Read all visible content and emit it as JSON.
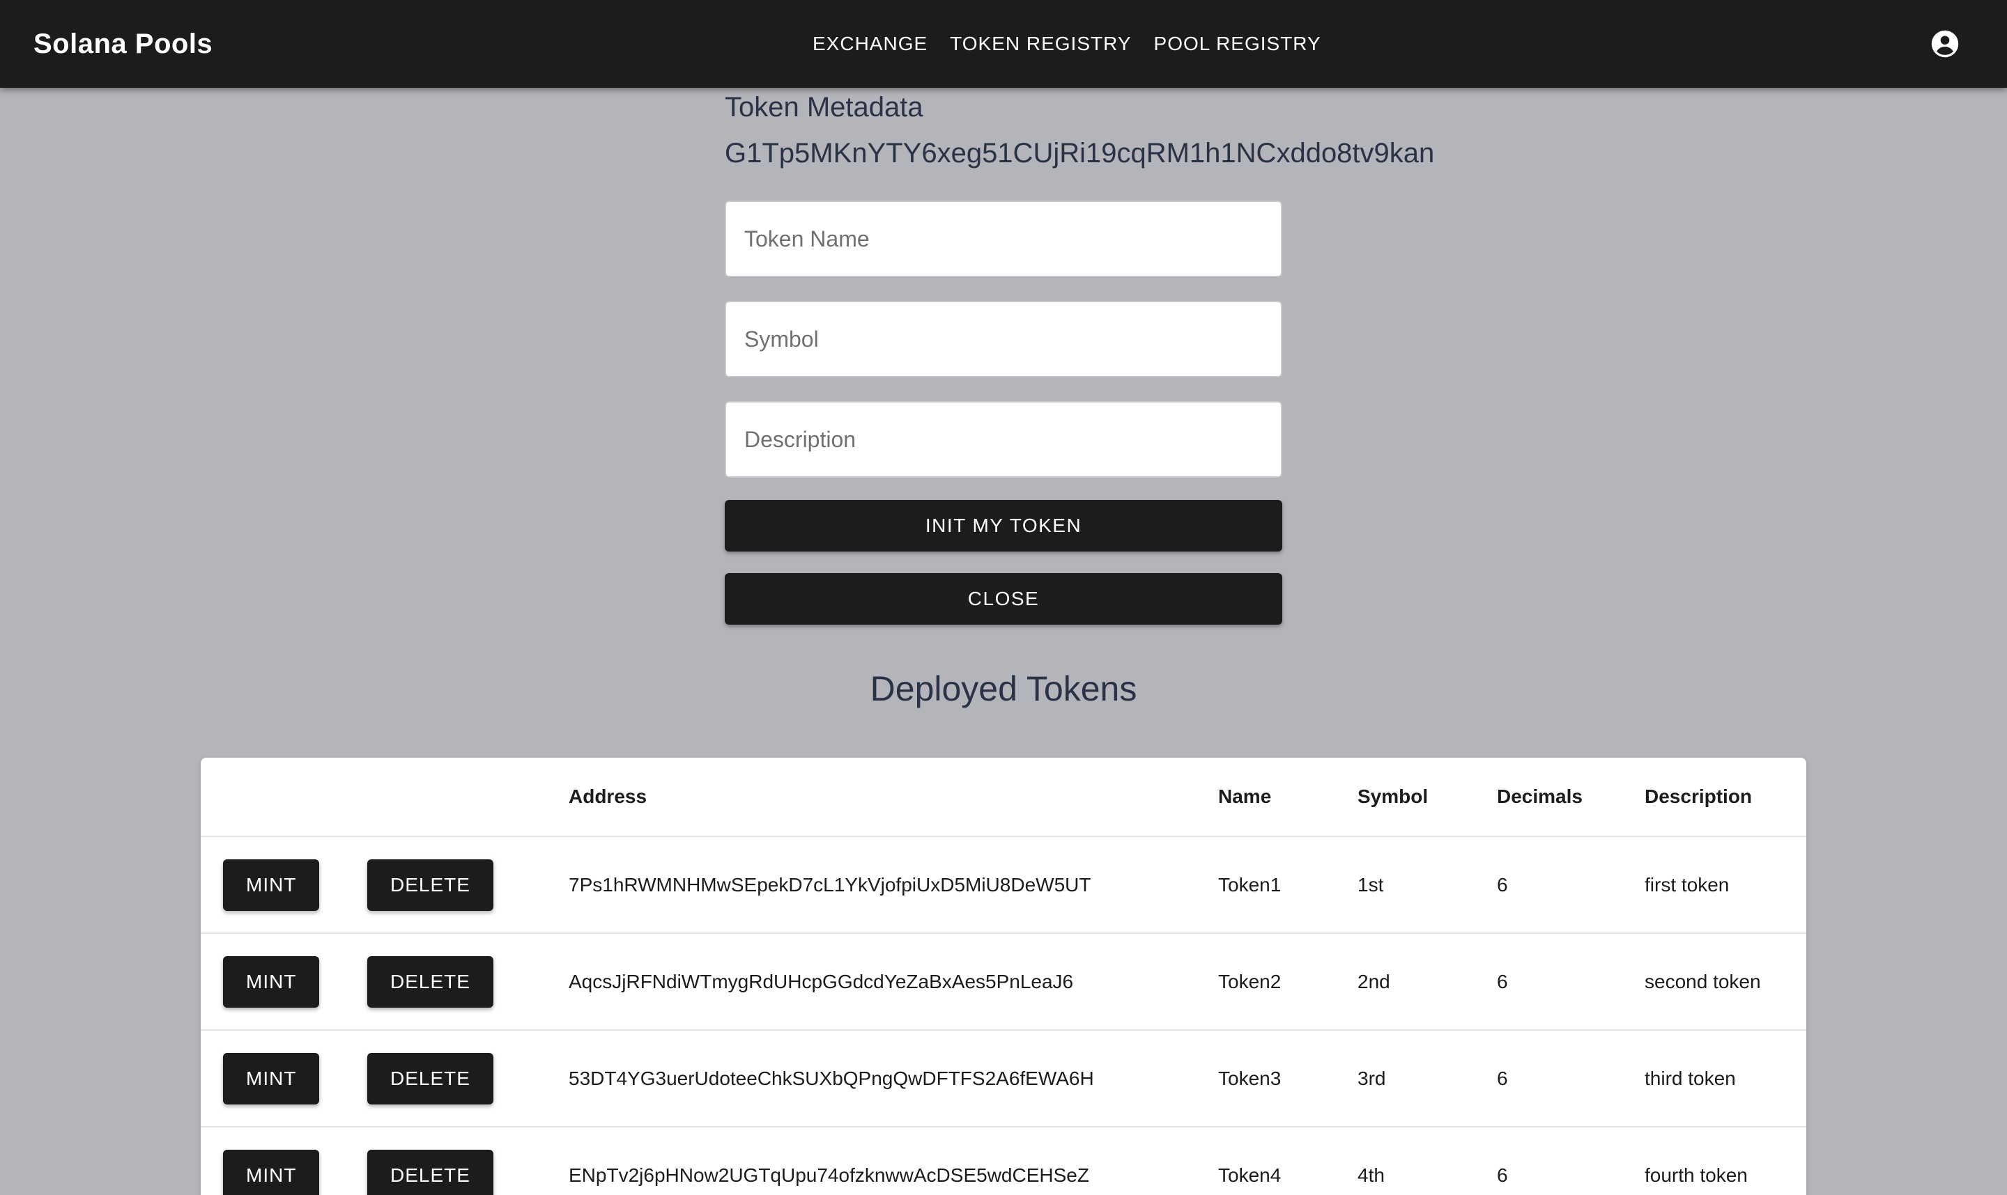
{
  "app": {
    "brand": "Solana Pools",
    "nav": [
      "EXCHANGE",
      "TOKEN REGISTRY",
      "POOL REGISTRY"
    ],
    "account_icon": "account-circle-icon"
  },
  "form": {
    "title": "Token Metadata",
    "address": "G1Tp5MKnYTY6xeg51CUjRi19cqRM1h1NCxddo8tv9kan",
    "fields": {
      "name_placeholder": "Token Name",
      "symbol_placeholder": "Symbol",
      "description_placeholder": "Description"
    },
    "init_label": "INIT MY TOKEN",
    "close_label": "CLOSE"
  },
  "tokens": {
    "title": "Deployed Tokens",
    "headers": [
      "",
      "",
      "Address",
      "Name",
      "Symbol",
      "Decimals",
      "Description"
    ],
    "mint_label": "MINT",
    "delete_label": "DELETE",
    "rows": [
      {
        "address": "7Ps1hRWMNHMwSEpekD7cL1YkVjofpiUxD5MiU8DeW5UT",
        "name": "Token1",
        "symbol": "1st",
        "decimals": "6",
        "description": "first token"
      },
      {
        "address": "AqcsJjRFNdiWTmygRdUHcpGGdcdYeZaBxAes5PnLeaJ6",
        "name": "Token2",
        "symbol": "2nd",
        "decimals": "6",
        "description": "second token"
      },
      {
        "address": "53DT4YG3uerUdoteeChkSUXbQPngQwDFTFS2A6fEWA6H",
        "name": "Token3",
        "symbol": "3rd",
        "decimals": "6",
        "description": "third token"
      },
      {
        "address": "ENpTv2j6pHNow2UGTqUpu74ofzknwwAcDSE5wdCEHSeZ",
        "name": "Token4",
        "symbol": "4th",
        "decimals": "6",
        "description": "fourth token"
      }
    ]
  }
}
